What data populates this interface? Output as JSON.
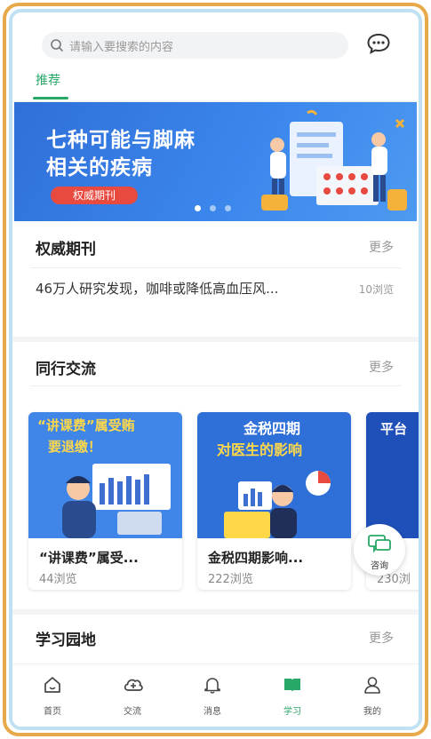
{
  "search": {
    "placeholder": "请输入要搜索的内容",
    "icon": "search-icon"
  },
  "header": {
    "message_icon": "chat-bubble-icon"
  },
  "tabs": [
    {
      "label": "推荐",
      "active": true
    }
  ],
  "banner": {
    "line1": "七种可能与脚麻",
    "line2": "相关的疾病",
    "tag": "权威期刊",
    "slides": 3,
    "active_slide": 0
  },
  "journal": {
    "title": "权威期刊",
    "more": "更多",
    "item": {
      "text": "46万人研究发现，咖啡或降低高血压风...",
      "views": "10浏览"
    }
  },
  "exchange": {
    "title": "同行交流",
    "more": "更多",
    "cards": [
      {
        "image_title_line1": "“讲课费”属受贿",
        "image_title_line2": "要退缴！",
        "title": "“讲课费”属受...",
        "views": "44浏览"
      },
      {
        "image_title_line1": "金税四期",
        "image_title_line2": "对医生的影响",
        "title": "金税四期影响...",
        "views": "222浏览"
      },
      {
        "image_title_line1": "平台",
        "title": "",
        "views": "230浏"
      }
    ]
  },
  "float_button": {
    "label": "咨询",
    "icon": "consult-chat-icon"
  },
  "study": {
    "title": "学习园地",
    "more": "更多"
  },
  "bottom_nav": [
    {
      "label": "首页",
      "icon": "home-icon",
      "active": false
    },
    {
      "label": "交流",
      "icon": "cloud-plus-icon",
      "active": false
    },
    {
      "label": "消息",
      "icon": "bell-icon",
      "active": false
    },
    {
      "label": "学习",
      "icon": "book-icon",
      "active": true
    },
    {
      "label": "我的",
      "icon": "user-icon",
      "active": false
    }
  ],
  "colors": {
    "accent": "#27a867",
    "banner_blue": "#3b86ec",
    "tag_red": "#e84a40",
    "frame_orange": "#e7a94a"
  }
}
